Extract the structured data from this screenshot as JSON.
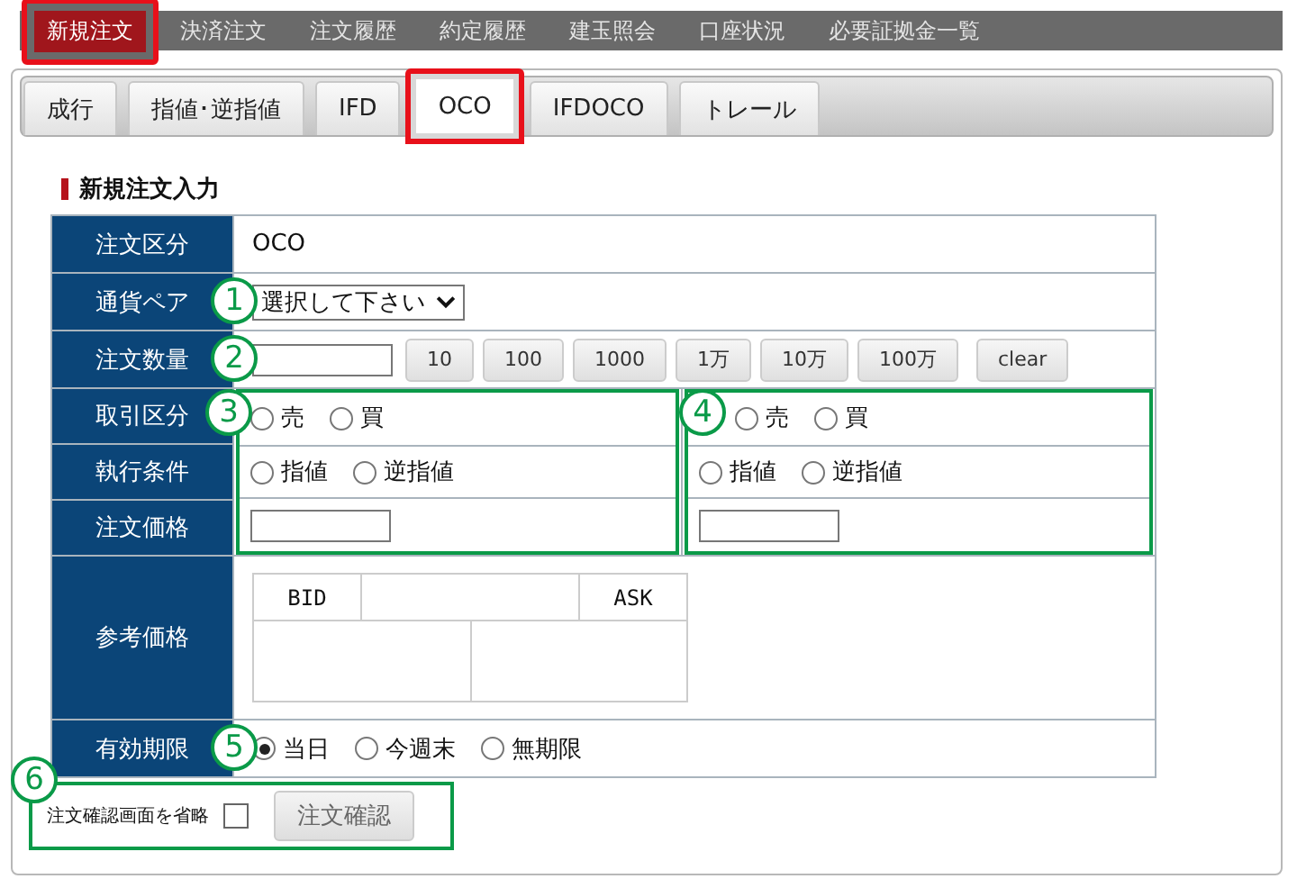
{
  "top_tabs": [
    {
      "label": "新規注文",
      "selected": true,
      "highlighted": true
    },
    {
      "label": "決済注文",
      "selected": false,
      "highlighted": false
    },
    {
      "label": "注文履歴",
      "selected": false,
      "highlighted": false
    },
    {
      "label": "約定履歴",
      "selected": false,
      "highlighted": false
    },
    {
      "label": "建玉照会",
      "selected": false,
      "highlighted": false
    },
    {
      "label": "口座状況",
      "selected": false,
      "highlighted": false
    },
    {
      "label": "必要証拠金一覧",
      "selected": false,
      "highlighted": false
    }
  ],
  "order_tabs": [
    {
      "label": "成行",
      "selected": false,
      "highlighted": false
    },
    {
      "label": "指値･逆指値",
      "selected": false,
      "highlighted": false
    },
    {
      "label": "IFD",
      "selected": false,
      "highlighted": false
    },
    {
      "label": "OCO",
      "selected": true,
      "highlighted": true
    },
    {
      "label": "IFDOCO",
      "selected": false,
      "highlighted": false
    },
    {
      "label": "トレール",
      "selected": false,
      "highlighted": false
    }
  ],
  "section_title": "新規注文入力",
  "rows": [
    {
      "kind": "text",
      "label": "注文区分",
      "value": "OCO"
    },
    {
      "kind": "select",
      "label": "通貨ペア",
      "value": "選択して下さい",
      "marker": "1"
    },
    {
      "kind": "quantity",
      "label": "注文数量",
      "marker": "2",
      "buttons": [
        "10",
        "100",
        "1000",
        "1万",
        "10万",
        "100万",
        "clear"
      ]
    },
    {
      "kind": "legs",
      "labels": [
        "取引区分",
        "執行条件",
        "注文価格"
      ],
      "legs": [
        {
          "marker": "3",
          "highlighted": true,
          "side": [
            {
              "label": "売",
              "selected": false
            },
            {
              "label": "買",
              "selected": false
            }
          ],
          "condition": [
            {
              "label": "指値",
              "selected": false
            },
            {
              "label": "逆指値",
              "selected": false
            }
          ]
        },
        {
          "marker": "4",
          "highlighted": true,
          "side": [
            {
              "label": "売",
              "selected": false
            },
            {
              "label": "買",
              "selected": false
            }
          ],
          "condition": [
            {
              "label": "指値",
              "selected": false
            },
            {
              "label": "逆指値",
              "selected": false
            }
          ]
        }
      ]
    },
    {
      "kind": "quote",
      "label": "参考価格",
      "headers": [
        "BID",
        "ASK"
      ]
    },
    {
      "kind": "radios",
      "label": "有効期限",
      "marker": "5",
      "options": [
        {
          "label": "当日",
          "selected": true
        },
        {
          "label": "今週末",
          "selected": false
        },
        {
          "label": "無期限",
          "selected": false
        }
      ]
    }
  ],
  "footer": {
    "marker": "6",
    "highlighted": true,
    "skip_label": "注文確認画面を省略",
    "skip_checked": false,
    "confirm_button": "注文確認"
  }
}
